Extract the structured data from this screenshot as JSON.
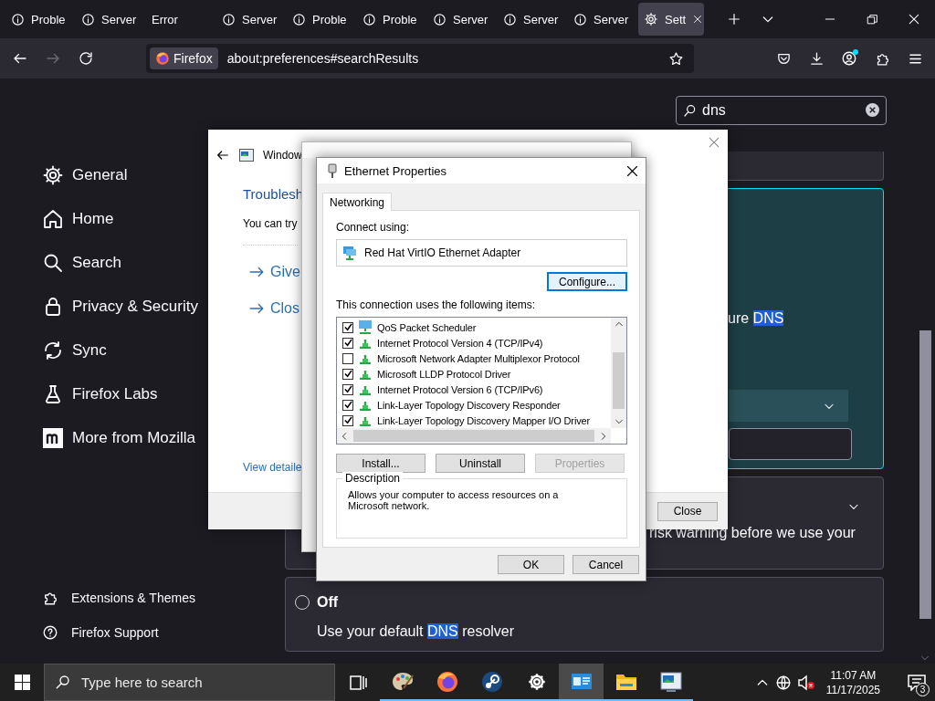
{
  "browser_tabs": [
    {
      "label": "Proble",
      "kind": "info",
      "selected": false
    },
    {
      "label": "Server",
      "kind": "info",
      "selected": false
    },
    {
      "label": "Error",
      "kind": "none",
      "selected": false
    },
    {
      "label": "Server",
      "kind": "info",
      "selected": false
    },
    {
      "label": "Proble",
      "kind": "info",
      "selected": false
    },
    {
      "label": "Proble",
      "kind": "info",
      "selected": false
    },
    {
      "label": "Server",
      "kind": "info",
      "selected": false
    },
    {
      "label": "Server",
      "kind": "info",
      "selected": false
    },
    {
      "label": "Server",
      "kind": "info",
      "selected": false
    },
    {
      "label": "Sett",
      "kind": "settings",
      "selected": true
    }
  ],
  "navigation": {
    "forward": {
      "disabled": true
    }
  },
  "address_bar": {
    "identity": "Firefox",
    "url": "about:preferences#searchResults"
  },
  "sidebar": {
    "items": [
      {
        "label": "General"
      },
      {
        "label": "Home"
      },
      {
        "label": "Search"
      },
      {
        "label": "Privacy & Security"
      },
      {
        "label": "Sync"
      },
      {
        "label": "Firefox Labs"
      },
      {
        "label": "More from Mozilla"
      }
    ],
    "footer_items": [
      {
        "label": "Extensions & Themes"
      },
      {
        "label": "Firefox Support"
      }
    ]
  },
  "search": {
    "value": "dns"
  },
  "dns_cards": {
    "primary_text": [
      {
        "text": "ure ",
        "highlight": false
      },
      {
        "text": "DNS",
        "highlight": true
      }
    ],
    "warning_text": "risk warning before we use your",
    "off_option": {
      "label": "Off",
      "selected": false,
      "description": [
        {
          "text": "Use your default ",
          "highlight": false
        },
        {
          "text": "DNS",
          "highlight": true
        },
        {
          "text": " resolver",
          "highlight": false
        }
      ]
    }
  },
  "troubleshooter": {
    "title": "Window",
    "heading": "Troublesh",
    "intro": "You can try",
    "options": [
      "Give",
      "Clos"
    ],
    "details_link": "View detaile",
    "close_button": "Close"
  },
  "ethernet_properties": {
    "title": "Ethernet Properties",
    "tab": {
      "label": "Networking",
      "selected": true
    },
    "connect_label": "Connect using:",
    "adapter": "Red Hat VirtIO Ethernet Adapter",
    "configure_button": "Configure...",
    "items_label": "This connection uses the following items:",
    "items": [
      {
        "label": "QoS Packet Scheduler",
        "kind": "service",
        "checked": true
      },
      {
        "label": "Internet Protocol Version 4 (TCP/IPv4)",
        "kind": "protocol",
        "checked": true
      },
      {
        "label": "Microsoft Network Adapter Multiplexor Protocol",
        "kind": "protocol",
        "checked": false
      },
      {
        "label": "Microsoft LLDP Protocol Driver",
        "kind": "protocol",
        "checked": true
      },
      {
        "label": "Internet Protocol Version 6 (TCP/IPv6)",
        "kind": "protocol",
        "checked": true
      },
      {
        "label": "Link-Layer Topology Discovery Responder",
        "kind": "protocol",
        "checked": true
      },
      {
        "label": "Link-Layer Topology Discovery Mapper I/O Driver",
        "kind": "protocol",
        "checked": true
      }
    ],
    "buttons": [
      {
        "label": "Install...",
        "disabled": false
      },
      {
        "label": "Uninstall",
        "disabled": false
      },
      {
        "label": "Properties",
        "disabled": true
      }
    ],
    "description_label": "Description",
    "description": "Allows your computer to access resources on a Microsoft network.",
    "dialog_buttons": [
      "OK",
      "Cancel"
    ]
  },
  "taskbar": {
    "search_placeholder": "Type here to search",
    "apps": [
      {
        "kind": "task-view",
        "running": false,
        "active": false
      },
      {
        "kind": "paint",
        "running": true,
        "active": false
      },
      {
        "kind": "firefox",
        "running": true,
        "active": false
      },
      {
        "kind": "steam",
        "running": true,
        "active": false
      },
      {
        "kind": "settings",
        "running": true,
        "active": false
      },
      {
        "kind": "network",
        "running": true,
        "active": true
      },
      {
        "kind": "folder",
        "running": true,
        "active": false
      },
      {
        "kind": "monitor",
        "running": true,
        "active": false
      }
    ],
    "time": "11:07 AM",
    "date": "11/17/2025",
    "notification_count": "3"
  }
}
